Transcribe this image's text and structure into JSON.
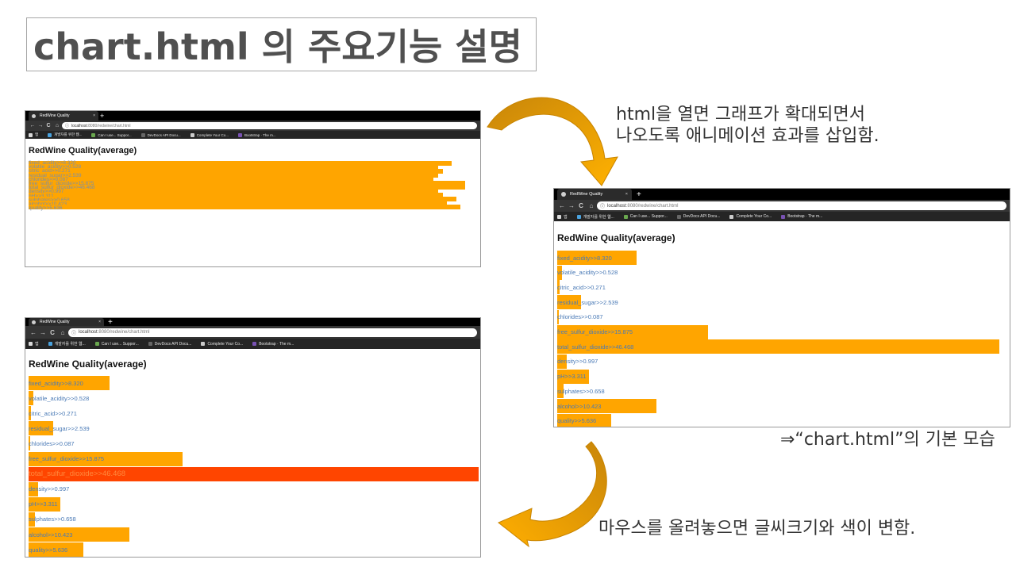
{
  "slide": {
    "title": "chart.html 의 주요기능 설명",
    "note_top_line1": "html을 열면 그래프가 확대되면서",
    "note_top_line2": "나오도록 애니메이션 효과를 삽입함.",
    "caption_right": "⇒“chart.html”의 기본 모습",
    "note_bottom": "마우스를 올려놓으면 글씨크기와 색이 변함."
  },
  "browser": {
    "tab_title": "RedWine Quality",
    "tab_close": "×",
    "new_tab": "+",
    "nav_back": "←",
    "nav_forward": "→",
    "nav_reload": "C",
    "nav_home": "⌂",
    "info_icon": "ⓘ",
    "url_host": "localhost",
    "url_path": ":8080/redwine/chart.html",
    "bookmarks": [
      {
        "label": "앱",
        "color": "#d9d9d9"
      },
      {
        "label": "개발자를 위한 웹...",
        "color": "#4aa3df"
      },
      {
        "label": "Can I use... Suppor...",
        "color": "#6aa84f"
      },
      {
        "label": "DevDocs API Docu...",
        "color": "#666666"
      },
      {
        "label": "Complete Your Co...",
        "color": "#cccccc"
      },
      {
        "label": "Bootstrap · The m...",
        "color": "#7952b3"
      }
    ]
  },
  "page": {
    "heading": "RedWine Quality(average)"
  },
  "chart_data": {
    "type": "bar",
    "orientation": "horizontal",
    "title": "RedWine Quality(average)",
    "categories": [
      "fixed_acidity",
      "volatile_acidity",
      "citric_acid",
      "residual_sugar",
      "chlorides",
      "free_sulfur_dioxide",
      "total_sulfur_dioxide",
      "density",
      "pH",
      "sulphates",
      "alcohol",
      "quality"
    ],
    "labels": [
      "fixed_acidity>>8.320",
      "volatile_acidity>>0.528",
      "citric_acid>>0.271",
      "residual_sugar>>2.539",
      "chlorides>>0.087",
      "free_sulfur_dioxide>>15.875",
      "total_sulfur_dioxide>>46.468",
      "density>>0.997",
      "pH>>3.311",
      "sulphates>>0.658",
      "alcohol>>10.423",
      "quality>>5.636"
    ],
    "values": [
      8.32,
      0.528,
      0.271,
      2.539,
      0.087,
      15.875,
      46.468,
      0.997,
      3.311,
      0.658,
      10.423,
      5.636
    ],
    "bar_color": "#ffa500",
    "hover_color": "#ff4500",
    "label_color": "#4a7ab6",
    "hover_index": 6,
    "animation_frame_fractions": [
      0.94,
      0.91,
      0.92,
      0.91,
      0.9,
      0.97,
      0.97,
      0.91,
      0.92,
      0.95,
      0.93,
      0.96
    ]
  }
}
